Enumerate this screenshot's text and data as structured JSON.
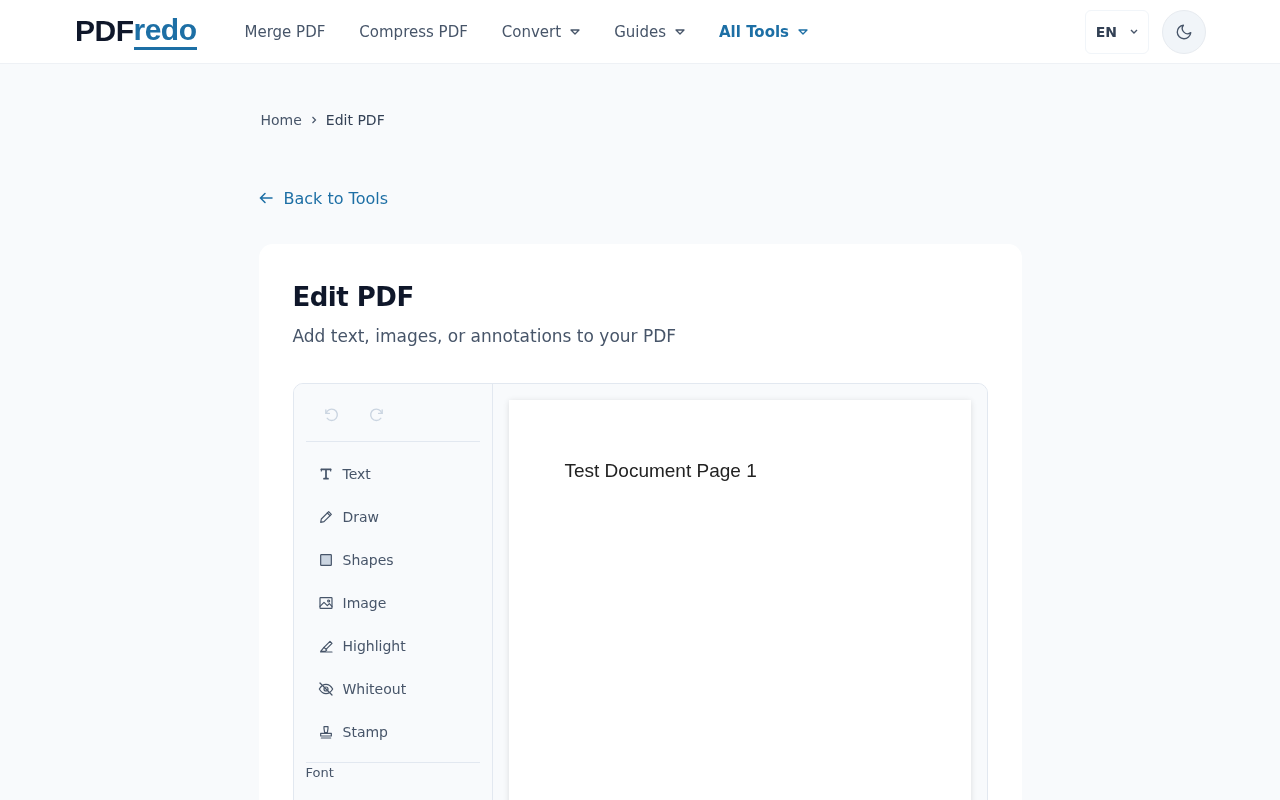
{
  "header": {
    "logo": {
      "dark": "PDF",
      "accent": "redo"
    },
    "nav": [
      {
        "label": "Merge PDF",
        "selected": false,
        "dropdown": false
      },
      {
        "label": "Compress PDF",
        "selected": false,
        "dropdown": false
      },
      {
        "label": "Convert",
        "selected": false,
        "dropdown": true
      },
      {
        "label": "Guides",
        "selected": false,
        "dropdown": true
      },
      {
        "label": "All Tools",
        "selected": true,
        "dropdown": true
      }
    ],
    "language": "EN"
  },
  "breadcrumb": [
    "Home",
    "Edit PDF"
  ],
  "back_link": "Back to Tools",
  "card": {
    "title": "Edit PDF",
    "subtitle": "Add text, images, or annotations to your PDF"
  },
  "editor": {
    "history": [
      {
        "disabled": true
      },
      {
        "disabled": true
      }
    ],
    "tools": [
      {
        "label": "Text",
        "selected": false
      },
      {
        "label": "Draw",
        "selected": false
      },
      {
        "label": "Shapes",
        "selected": false
      },
      {
        "label": "Image",
        "selected": false
      },
      {
        "label": "Highlight",
        "selected": false
      },
      {
        "label": "Whiteout",
        "selected": false
      },
      {
        "label": "Stamp",
        "selected": false
      }
    ],
    "section_label": "Font",
    "page_text": "Test Document Page 1"
  }
}
